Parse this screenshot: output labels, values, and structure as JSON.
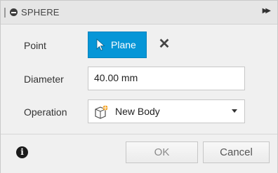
{
  "dialog": {
    "title": "SPHERE"
  },
  "rows": {
    "point_label": "Point",
    "point_select_label": "Plane",
    "diameter_label": "Diameter",
    "diameter_value": "40.00 mm",
    "operation_label": "Operation",
    "operation_value": "New Body"
  },
  "footer": {
    "ok_label": "OK",
    "cancel_label": "Cancel"
  },
  "icons": {
    "title": "sphere-minus-icon",
    "expand": "double-arrow-right-icon",
    "select": "cursor-arrow-icon",
    "clear": "close-icon",
    "operation": "new-body-icon",
    "info": "info-icon"
  },
  "colors": {
    "accent": "#0696d7",
    "new_body_star": "#f39c12"
  }
}
